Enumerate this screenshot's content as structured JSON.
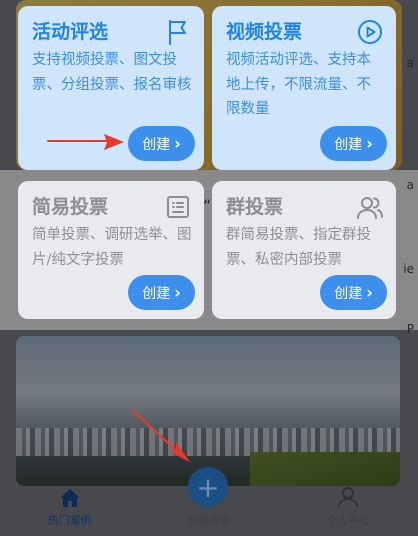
{
  "cards": [
    {
      "title": "活动评选",
      "description": "支持视频投票、图文投票、分组投票、报名审核",
      "button_label": "创建",
      "icon": "flag-icon",
      "style": "blue"
    },
    {
      "title": "视频投票",
      "description": "视频活动评选、支持本地上传，不限流量、不限数量",
      "button_label": "创建",
      "icon": "play-circle-icon",
      "style": "blue"
    },
    {
      "title": "简易投票",
      "description": "简单投票、调研选举、图片/纯文字投票",
      "button_label": "创建",
      "icon": "form-icon",
      "style": "gray"
    },
    {
      "title": "群投票",
      "description": "群简易投票、指定群投票、私密内部投票",
      "button_label": "创建",
      "icon": "group-icon",
      "style": "gray"
    }
  ],
  "background_texts": [
    "“",
    "a",
    "a",
    "ie",
    "P"
  ],
  "tabbar": {
    "items": [
      {
        "label": "热门案例",
        "icon": "home-icon",
        "active": true
      },
      {
        "label": "创建投票",
        "icon": "plus-icon",
        "active": false
      },
      {
        "label": "个人中心",
        "icon": "user-icon",
        "active": false
      }
    ]
  },
  "colors": {
    "accent": "#3d8fec",
    "card_blue": "#cfe5fb",
    "card_gray": "#e9eaed",
    "arrow": "#e8392c"
  }
}
